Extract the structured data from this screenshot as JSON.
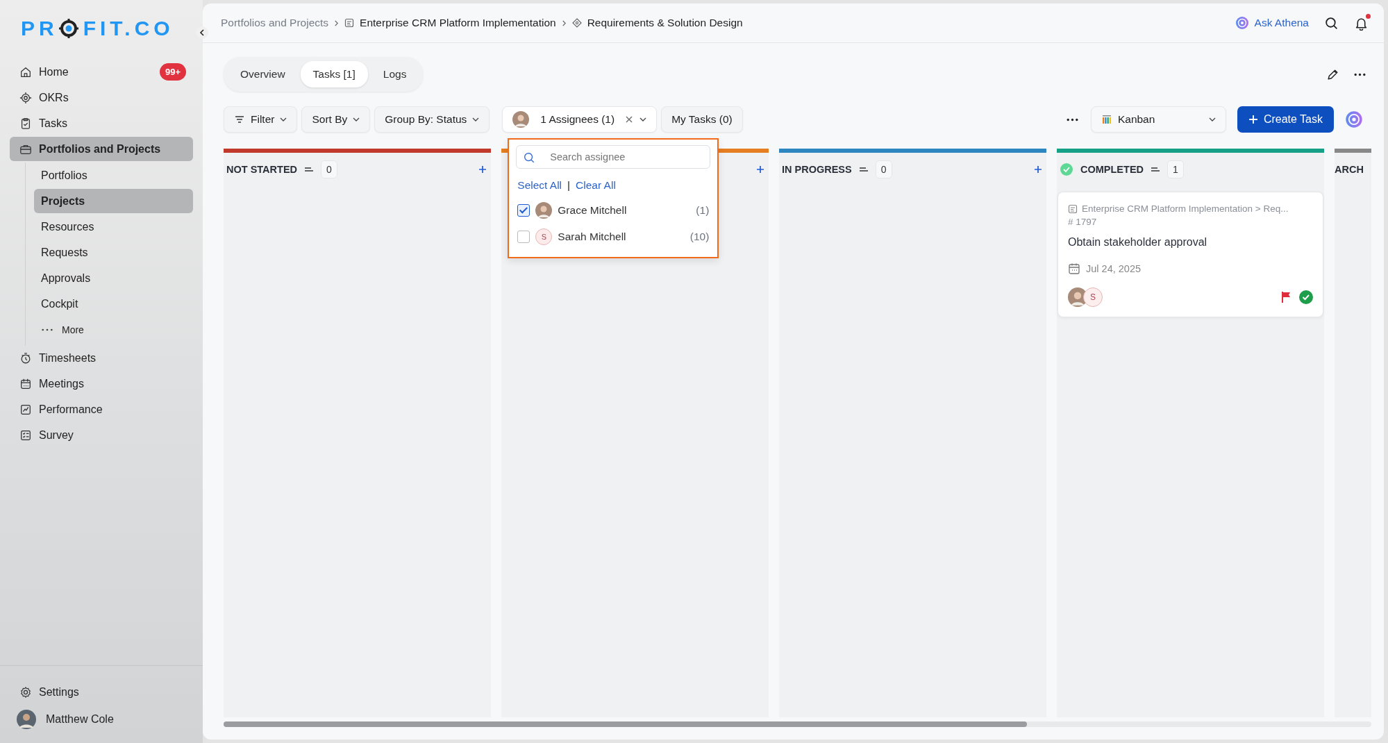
{
  "logo": {
    "left": "PR",
    "right": "FIT.CO"
  },
  "sidebar": {
    "items": [
      {
        "label": "Home",
        "badge": "99+",
        "selected": false
      },
      {
        "label": "OKRs",
        "selected": false
      },
      {
        "label": "Tasks",
        "selected": false
      },
      {
        "label": "Portfolios and Projects",
        "selected": true,
        "children": [
          {
            "label": "Portfolios",
            "selected": false
          },
          {
            "label": "Projects",
            "selected": true
          },
          {
            "label": "Resources",
            "selected": false
          },
          {
            "label": "Requests",
            "selected": false
          },
          {
            "label": "Approvals",
            "selected": false
          },
          {
            "label": "Cockpit",
            "selected": false
          },
          {
            "label": "More",
            "kind": "more",
            "selected": false
          }
        ]
      },
      {
        "label": "Timesheets",
        "selected": false
      },
      {
        "label": "Meetings",
        "selected": false
      },
      {
        "label": "Performance",
        "selected": false
      },
      {
        "label": "Survey",
        "selected": false
      }
    ],
    "settings": "Settings",
    "user": "Matthew Cole"
  },
  "breadcrumb": [
    "Portfolios and Projects",
    "Enterprise CRM Platform Implementation",
    "Requirements & Solution Design"
  ],
  "ask": "Ask Athena",
  "has_notification": true,
  "tabs": [
    {
      "label": "Overview",
      "selected": false
    },
    {
      "label": "Tasks [1]",
      "selected": true
    },
    {
      "label": "Logs",
      "selected": false
    }
  ],
  "toolbar": {
    "filter": "Filter",
    "sort": "Sort By",
    "group": "Group By: Status",
    "assignee": "1 Assignees (1)",
    "my_tasks": "My Tasks (0)",
    "view": "Kanban",
    "create": "Create Task"
  },
  "dropdown": {
    "placeholder": "Search assignee",
    "select_all": "Select All",
    "separator": "|",
    "clear_all": "Clear All",
    "options": [
      {
        "name": "Grace Mitchell",
        "count": "(1)",
        "checked": true,
        "kind": "photo"
      },
      {
        "name": "Sarah Mitchell",
        "count": "(10)",
        "checked": false,
        "kind": "initial",
        "initial": "S"
      }
    ]
  },
  "columns": [
    {
      "title": "NOT STARTED",
      "count": "0",
      "color": "#c0392b",
      "can_add": true,
      "done": false
    },
    {
      "color": "#e67e22",
      "can_add": true,
      "done": false
    },
    {
      "title": "IN PROGRESS",
      "count": "0",
      "color": "#2e86c1",
      "can_add": true,
      "done": false
    },
    {
      "title": "COMPLETED",
      "count": "1",
      "color": "#16a085",
      "can_add": false,
      "done": true,
      "cards": [
        {
          "path": "Enterprise CRM Platform Implementation > Req...",
          "id": "# 1797",
          "title": "Obtain stakeholder approval",
          "date": "Jul 24, 2025",
          "flagged": true,
          "done": true,
          "assignees": [
            {
              "kind": "photo"
            },
            {
              "kind": "initial",
              "initial": "S"
            }
          ]
        }
      ]
    },
    {
      "title": "ARCH",
      "color": "#888888",
      "can_add": false,
      "done": false
    }
  ]
}
